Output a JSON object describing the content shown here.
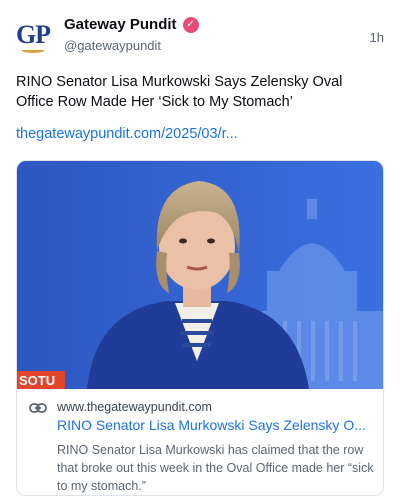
{
  "author": {
    "avatar_text": "GP",
    "display_name": "Gateway Pundit",
    "handle": "@gatewaypundit",
    "verified_icon": "verified-badge-icon",
    "timestamp": "1h"
  },
  "post": {
    "text": "RINO Senator Lisa Murkowski Says Zelensky Oval Office Row Made Her ‘Sick to My Stomach’",
    "link_text": "thegatewaypundit.com/2025/03/r..."
  },
  "link_card": {
    "image_caption": "SOTU",
    "icon": "link-icon",
    "domain": "www.thegatewaypundit.com",
    "title": "RINO Senator Lisa Murkowski Says Zelensky O...",
    "description": "RINO Senator Lisa Murkowski has claimed that the row that broke out this week in the Oval Office made her “sick to my stomach.”"
  },
  "colors": {
    "link": "#1a73e8",
    "verified": "#e84b7a",
    "brand_blue": "#1f3f8c",
    "image_background": "#2f5fc9",
    "caption_bar": "#e2452c"
  }
}
